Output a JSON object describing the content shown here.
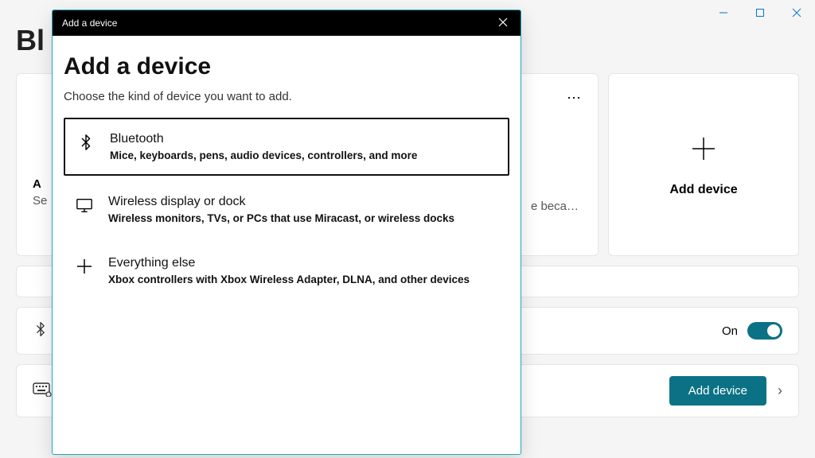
{
  "window": {
    "minimize": "—",
    "maximize": "▢",
    "close": "✕"
  },
  "bg": {
    "title_prefix": "Bl",
    "more": "⋯",
    "add_device_card": "Add device",
    "panel_line1_label": "A",
    "panel_line2_label": "Se",
    "truncated": "e beca…",
    "bt_toggle_label": "On",
    "add_device_button": "Add device"
  },
  "modal": {
    "titlebar": "Add a device",
    "close": "✕",
    "heading": "Add a device",
    "subtitle": "Choose the kind of device you want to add.",
    "options": [
      {
        "title": "Bluetooth",
        "desc": "Mice, keyboards, pens, audio devices, controllers, and more"
      },
      {
        "title": "Wireless display or dock",
        "desc": "Wireless monitors, TVs, or PCs that use Miracast, or wireless docks"
      },
      {
        "title": "Everything else",
        "desc": "Xbox controllers with Xbox Wireless Adapter, DLNA, and other devices"
      }
    ]
  }
}
